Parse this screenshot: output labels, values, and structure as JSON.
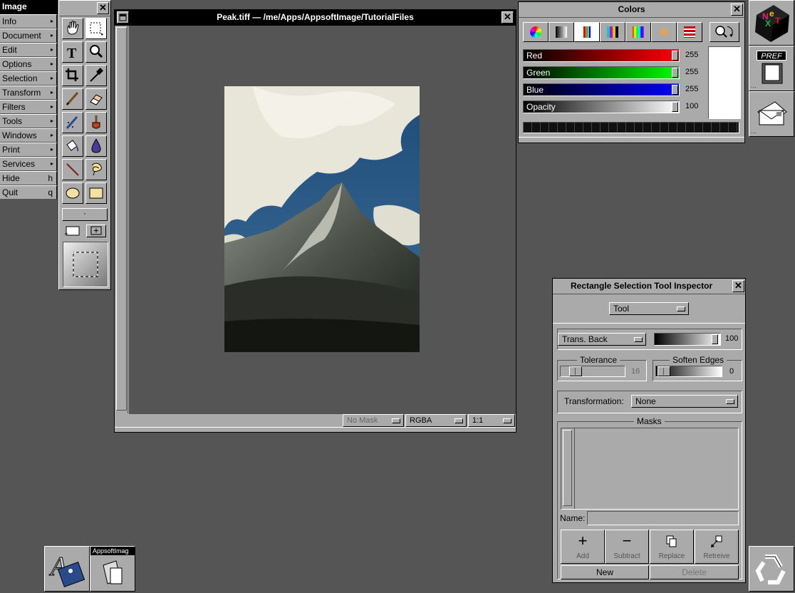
{
  "menu": {
    "title": "Image",
    "items": [
      {
        "label": "Info",
        "key": ""
      },
      {
        "label": "Document",
        "key": ""
      },
      {
        "label": "Edit",
        "key": ""
      },
      {
        "label": "Options",
        "key": ""
      },
      {
        "label": "Selection",
        "key": ""
      },
      {
        "label": "Transform",
        "key": ""
      },
      {
        "label": "Filters",
        "key": ""
      },
      {
        "label": "Tools",
        "key": ""
      },
      {
        "label": "Windows",
        "key": ""
      },
      {
        "label": "Print",
        "key": ""
      },
      {
        "label": "Services",
        "key": ""
      },
      {
        "label": "Hide",
        "key": "h"
      },
      {
        "label": "Quit",
        "key": "q"
      }
    ],
    "submenu_glyph": "▸"
  },
  "toolbox": {
    "close_glyph": "✕",
    "tools": [
      "hand-icon",
      "rect-select-icon",
      "text-icon",
      "magnifier-icon",
      "crop-icon",
      "eyedropper-icon",
      "pencil-icon",
      "eraser-icon",
      "airbrush-icon",
      "brush-icon",
      "bucket-icon",
      "drop-icon",
      "line-icon",
      "lasso-icon",
      "ellipse-icon",
      "rectangle-icon"
    ],
    "dot_label": "·"
  },
  "document": {
    "title": "Peak.tiff  —  /me/Apps/AppsoftImage/TutorialFiles",
    "mask_popup": "No Mask",
    "mode_popup": "RGBA",
    "zoom_popup": "1:1"
  },
  "colors": {
    "title": "Colors",
    "sliders": [
      {
        "label": "Red",
        "value": "255"
      },
      {
        "label": "Green",
        "value": "255"
      },
      {
        "label": "Blue",
        "value": "255"
      },
      {
        "label": "Opacity",
        "value": "100"
      }
    ],
    "swatch_color": "#ffffff"
  },
  "inspector": {
    "title": "Rectangle Selection Tool Inspector",
    "mode_popup": "Tool",
    "trans_popup": "Trans. Back",
    "trans_value": "100",
    "tolerance_label": "Tolerance",
    "tolerance_value": "16",
    "soften_label": "Soften Edges",
    "soften_value": "0",
    "transformation_label": "Transformation:",
    "transformation_value": "None",
    "masks_label": "Masks",
    "name_label": "Name:",
    "buttons": {
      "add": "Add",
      "subtract": "Subtract",
      "replace": "Replace",
      "retreive": "Retreive"
    },
    "new_label": "New",
    "delete_label": "Delete"
  },
  "dock": {
    "pref_label": "PREF",
    "app_label": "AppsoftImag",
    "next_letters": [
      "N",
      "e",
      "X",
      "T"
    ]
  }
}
